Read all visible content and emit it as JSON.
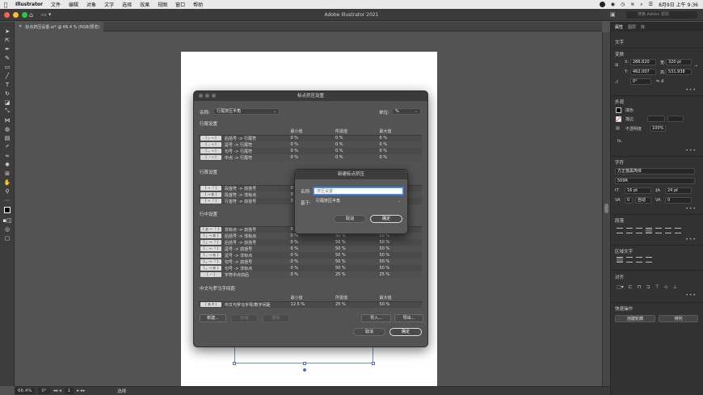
{
  "menubar": {
    "app": "Illustrator",
    "items": [
      "文件",
      "编辑",
      "对象",
      "文字",
      "选择",
      "效果",
      "视图",
      "窗口",
      "帮助"
    ],
    "clock": "8月9日 上午 9:36"
  },
  "titlebar": {
    "title": "Adobe Illustrator 2021",
    "search_placeholder": "搜索 Adobe 帮助"
  },
  "doc": {
    "tab_label": "标点挤压设置.ai* @ 66.4 % (RGB/预览)"
  },
  "status": {
    "zoom": "66.4%",
    "rotation": "0°",
    "artboard": "1",
    "mode": "选择"
  },
  "panel": {
    "tabs": [
      "属性",
      "图层",
      "库"
    ],
    "section_text": "文字",
    "section_transform": "变换",
    "x_label": "X:",
    "x_value": "286.620",
    "y_label": "Y:",
    "y_value": "462.007",
    "w_label": "宽:",
    "w_value": "320 pt",
    "h_label": "高:",
    "h_value": "531.938",
    "angle": "0°",
    "section_appearance": "外观",
    "fill": "填色",
    "stroke": "描边",
    "opacity_label": "不透明度",
    "opacity_value": "100%",
    "fx": "fx.",
    "section_char": "字符",
    "font_family": "方正悠黑简体",
    "font_style": "509R",
    "font_size": "16 pt",
    "leading": "24 pt",
    "tracking_a": "0",
    "tracking_b": "自动",
    "tracking_c": "0",
    "section_para": "段落",
    "section_area": "区域文字",
    "section_align": "对齐",
    "section_quick": "快速操作",
    "btn_outline": "创建轮廓",
    "btn_arrange": "排列"
  },
  "dialog": {
    "title": "标点挤压设置",
    "name_label": "名称:",
    "name_value": "行尾挤压半角",
    "unit_label": "单位:",
    "unit_value": "%",
    "col_min": "最小值",
    "col_want": "所需值",
    "col_max": "最大值",
    "sections": [
      {
        "title": "行尾设置",
        "rows": [
          {
            "icon": "[ 」→ ]",
            "label": "后括号 -> 行尾符",
            "min": "0 %",
            "want": "0 %",
            "max": "0 %"
          },
          {
            "icon": "[ 、→ ]",
            "label": "逗号 -> 行尾符",
            "min": "0 %",
            "want": "0 %",
            "max": "0 %"
          },
          {
            "icon": "[ 。→ ]",
            "label": "句号 -> 行尾符",
            "min": "0 %",
            "want": "0 %",
            "max": "0 %"
          },
          {
            "icon": "[ ・→ ]",
            "label": "中点 -> 行尾符",
            "min": "0 %",
            "want": "0 %",
            "max": "0 %"
          }
        ]
      },
      {
        "title": "行首设置",
        "rows": [
          {
            "icon": "[ → 「 ]",
            "label": "段首符 -> 前括号",
            "min": "0 %",
            "want": "",
            "max": ""
          },
          {
            "icon": "[ → あ ]",
            "label": "段首符 -> 非标点",
            "min": "0 %",
            "want": "",
            "max": ""
          },
          {
            "icon": "[ → 「 ]",
            "label": "行首符 -> 前括号",
            "min": "0 %",
            "want": "",
            "max": ""
          }
        ]
      },
      {
        "title": "行中设置",
        "rows": [
          {
            "icon": "[ あ → 「 ]",
            "label": "非标点 -> 前括号",
            "min": "0 %",
            "want": "",
            "max": ""
          },
          {
            "icon": "[ 」→ あ ]",
            "label": "后括号 -> 非标点",
            "min": "0 %",
            "want": "50 %",
            "max": "50 %"
          },
          {
            "icon": "[ 」→ 「 ]",
            "label": "后括号 -> 前括号",
            "min": "0 %",
            "want": "50 %",
            "max": "50 %"
          },
          {
            "icon": "[ 、→ 「 ]",
            "label": "逗号 -> 前括号",
            "min": "0 %",
            "want": "50 %",
            "max": "50 %"
          },
          {
            "icon": "[ 、→ あ ]",
            "label": "逗号 -> 非标点",
            "min": "0 %",
            "want": "50 %",
            "max": "50 %"
          },
          {
            "icon": "[ 。→ 「 ]",
            "label": "句号 -> 前括号",
            "min": "0 %",
            "want": "50 %",
            "max": "50 %"
          },
          {
            "icon": "[ 。→ あ ]",
            "label": "句号 -> 非标点",
            "min": "0 %",
            "want": "50 %",
            "max": "50 %"
          },
          {
            "icon": "[ ・ ]",
            "label": "字符中点前后",
            "min": "0 %",
            "want": "25 %",
            "max": "25 %"
          }
        ]
      },
      {
        "title": "中文与罗马字间距",
        "rows": [
          {
            "icon": "[ あ A ]",
            "label": "中文与罗马字母/数字间距",
            "min": "12.5 %",
            "want": "25 %",
            "max": "50 %"
          }
        ]
      }
    ],
    "btn_new": "新建...",
    "btn_save": "存储",
    "btn_delete": "删除",
    "btn_import": "导入...",
    "btn_export": "导出...",
    "btn_cancel": "取消",
    "btn_ok": "确定"
  },
  "subdialog": {
    "title": "新建标点挤压",
    "name_label": "名称:",
    "name_placeholder": "挤压设置",
    "base_label": "基于:",
    "base_value": "行尾挤压半角",
    "btn_cancel": "取消",
    "btn_ok": "确定"
  }
}
